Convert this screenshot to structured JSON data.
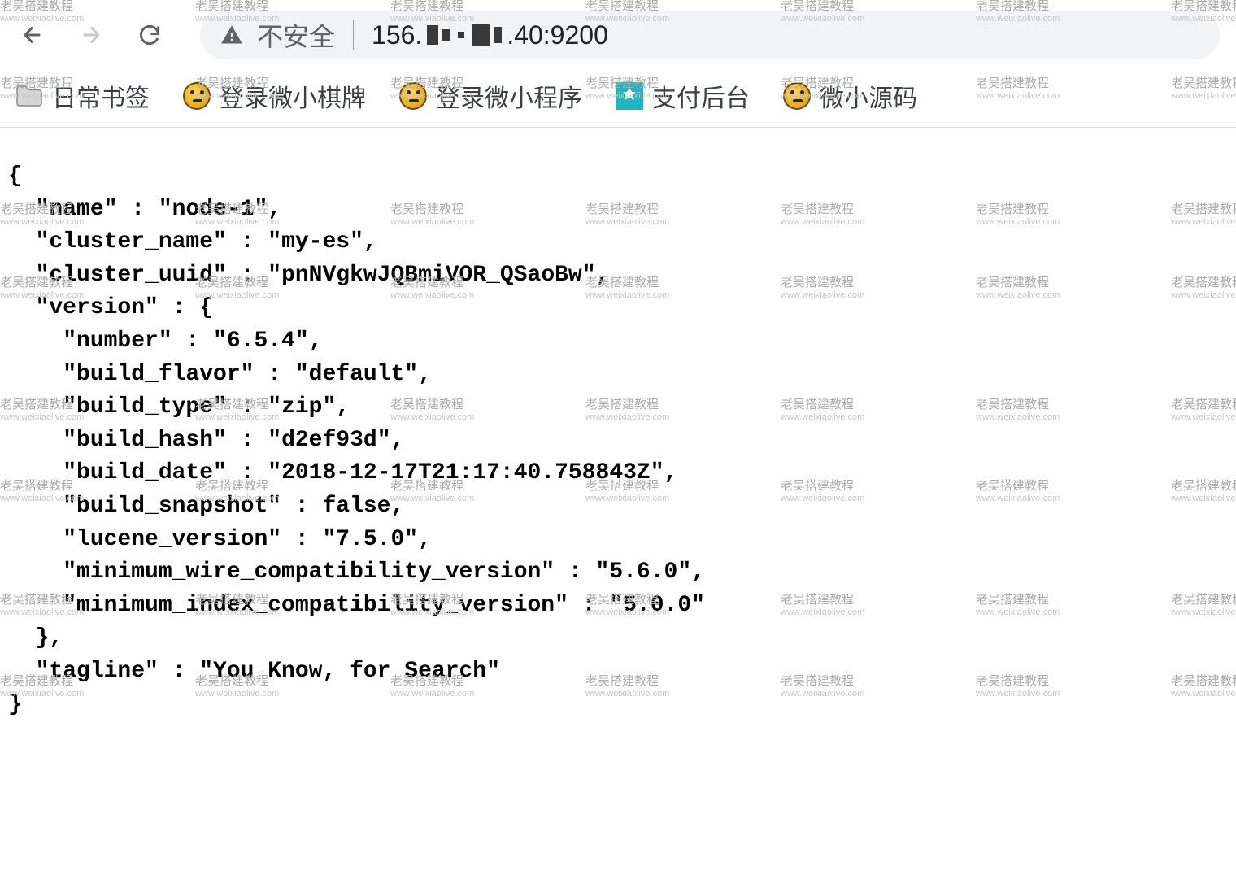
{
  "nav": {
    "security_label": "不安全",
    "url_prefix": "156.",
    "url_suffix": ".40:9200"
  },
  "bookmarks": [
    {
      "label": "日常书签",
      "icon": "folder"
    },
    {
      "label": "登录微小棋牌",
      "icon": "favicon-yellow"
    },
    {
      "label": "登录微小程序",
      "icon": "favicon-yellow"
    },
    {
      "label": "支付后台",
      "icon": "favicon-teal"
    },
    {
      "label": "微小源码",
      "icon": "favicon-yellow"
    }
  ],
  "response": {
    "name": "node-1",
    "cluster_name": "my-es",
    "cluster_uuid": "pnNVgkwJQBmiVOR_QSaoBw",
    "version": {
      "number": "6.5.4",
      "build_flavor": "default",
      "build_type": "zip",
      "build_hash": "d2ef93d",
      "build_date": "2018-12-17T21:17:40.758843Z",
      "build_snapshot": "false",
      "lucene_version": "7.5.0",
      "minimum_wire_compatibility_version": "5.6.0",
      "minimum_index_compatibility_version": "5.0.0"
    },
    "tagline": "You Know, for Search"
  },
  "watermark": {
    "title": "老吴搭建教程",
    "url": "www.weixiaolive.com"
  }
}
